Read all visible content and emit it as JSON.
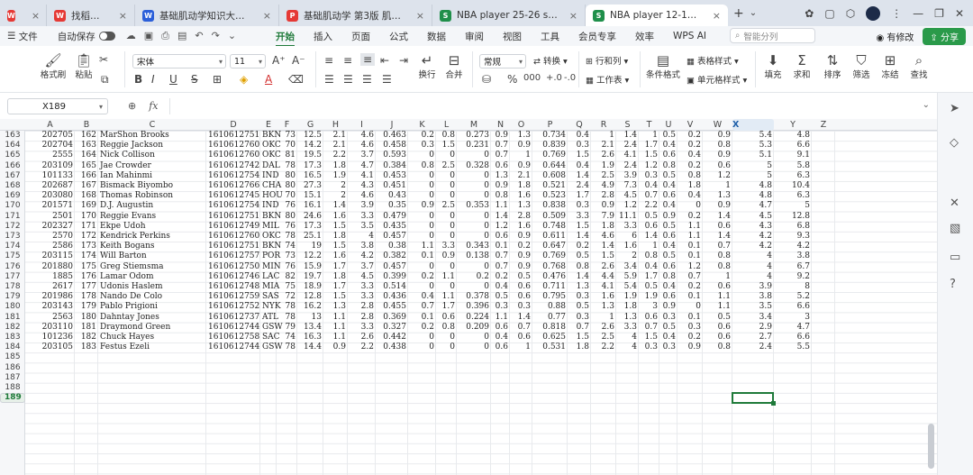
{
  "tabs": [
    {
      "label": "WPS",
      "icon": "wps-logo-icon",
      "color": "#e53935"
    },
    {
      "label": "找稻壳模板",
      "icon": "docer-icon",
      "color": "#e53935"
    },
    {
      "label": "基础肌动学知识大纲.docx",
      "icon": "word-doc-icon",
      "color": "#2b5fd9"
    },
    {
      "label": "基础肌动学 第3版 肌肉骨骼系统结构...",
      "icon": "pdf-icon",
      "color": "#e53935"
    },
    {
      "label": "NBA player 25-26 stats.xlsx",
      "icon": "sheet-icon",
      "color": "#1f8f4a"
    },
    {
      "label": "NBA player 12-13 stats.xlsx",
      "icon": "sheet-icon",
      "color": "#1f8f4a",
      "active": true
    }
  ],
  "menu": {
    "file": "文件",
    "autosave": "自动保存",
    "ribbon_tabs": [
      "开始",
      "插入",
      "页面",
      "公式",
      "数据",
      "审阅",
      "视图",
      "工具",
      "会员专享",
      "效率",
      "WPS AI"
    ],
    "active_tab": "开始",
    "search_placeholder": "智能分列",
    "modified": "有修改",
    "share": "分享"
  },
  "ribbon": {
    "format_painter": "格式刷",
    "paste": "粘贴",
    "font_name": "宋体",
    "font_size": "11",
    "wrap": "换行",
    "merge": "合并",
    "number_format": "常规",
    "convert": "转换",
    "rows_cols": "行和列",
    "worksheet": "工作表",
    "cond_format": "条件格式",
    "table_style": "表格样式",
    "cell_style": "单元格样式",
    "fill": "填充",
    "sum": "求和",
    "sort": "排序",
    "filter": "筛选",
    "freeze": "冻结",
    "find": "查找"
  },
  "formula_bar": {
    "cell_ref": "X189",
    "fx": "fx",
    "value": ""
  },
  "columns": [
    "A",
    "B",
    "C",
    "D",
    "E",
    "F",
    "G",
    "H",
    "I",
    "J",
    "K",
    "L",
    "M",
    "N",
    "O",
    "P",
    "Q",
    "R",
    "S",
    "T",
    "U",
    "V",
    "W",
    "X",
    "Y",
    "Z"
  ],
  "selected_column": "X",
  "selected_row": "189",
  "rows": [
    {
      "n": "163",
      "c": [
        "202705",
        "162",
        "MarShon Brooks",
        "1610612751",
        "BKN",
        "73",
        "12.5",
        "2.1",
        "4.6",
        "0.463",
        "0.2",
        "0.8",
        "0.273",
        "0.9",
        "1.3",
        "0.734",
        "0.4",
        "1",
        "1.4",
        "1",
        "0.5",
        "0.2",
        "0.9",
        "5.4",
        "4.8"
      ]
    },
    {
      "n": "164",
      "c": [
        "202704",
        "163",
        "Reggie Jackson",
        "1610612760",
        "OKC",
        "70",
        "14.2",
        "2.1",
        "4.6",
        "0.458",
        "0.3",
        "1.5",
        "0.231",
        "0.7",
        "0.9",
        "0.839",
        "0.3",
        "2.1",
        "2.4",
        "1.7",
        "0.4",
        "0.2",
        "0.8",
        "5.3",
        "6.6"
      ]
    },
    {
      "n": "165",
      "c": [
        "2555",
        "164",
        "Nick Collison",
        "1610612760",
        "OKC",
        "81",
        "19.5",
        "2.2",
        "3.7",
        "0.593",
        "0",
        "0",
        "0",
        "0.7",
        "1",
        "0.769",
        "1.5",
        "2.6",
        "4.1",
        "1.5",
        "0.6",
        "0.4",
        "0.9",
        "5.1",
        "9.1"
      ]
    },
    {
      "n": "166",
      "c": [
        "203109",
        "165",
        "Jae Crowder",
        "1610612742",
        "DAL",
        "78",
        "17.3",
        "1.8",
        "4.7",
        "0.384",
        "0.8",
        "2.5",
        "0.328",
        "0.6",
        "0.9",
        "0.644",
        "0.4",
        "1.9",
        "2.4",
        "1.2",
        "0.8",
        "0.2",
        "0.6",
        "5",
        "5.8"
      ]
    },
    {
      "n": "167",
      "c": [
        "101133",
        "166",
        "Ian Mahinmi",
        "1610612754",
        "IND",
        "80",
        "16.5",
        "1.9",
        "4.1",
        "0.453",
        "0",
        "0",
        "0",
        "1.3",
        "2.1",
        "0.608",
        "1.4",
        "2.5",
        "3.9",
        "0.3",
        "0.5",
        "0.8",
        "1.2",
        "5",
        "6.3"
      ]
    },
    {
      "n": "168",
      "c": [
        "202687",
        "167",
        "Bismack Biyombo",
        "1610612766",
        "CHA",
        "80",
        "27.3",
        "2",
        "4.3",
        "0.451",
        "0",
        "0",
        "0",
        "0.9",
        "1.8",
        "0.521",
        "2.4",
        "4.9",
        "7.3",
        "0.4",
        "0.4",
        "1.8",
        "1",
        "4.8",
        "10.4"
      ]
    },
    {
      "n": "169",
      "c": [
        "203080",
        "168",
        "Thomas Robinson",
        "1610612745",
        "HOU",
        "70",
        "15.1",
        "2",
        "4.6",
        "0.43",
        "0",
        "0",
        "0",
        "0.8",
        "1.6",
        "0.523",
        "1.7",
        "2.8",
        "4.5",
        "0.7",
        "0.6",
        "0.4",
        "1.3",
        "4.8",
        "6.3"
      ]
    },
    {
      "n": "170",
      "c": [
        "201571",
        "169",
        "D.J. Augustin",
        "1610612754",
        "IND",
        "76",
        "16.1",
        "1.4",
        "3.9",
        "0.35",
        "0.9",
        "2.5",
        "0.353",
        "1.1",
        "1.3",
        "0.838",
        "0.3",
        "0.9",
        "1.2",
        "2.2",
        "0.4",
        "0",
        "0.9",
        "4.7",
        "5"
      ]
    },
    {
      "n": "171",
      "c": [
        "2501",
        "170",
        "Reggie Evans",
        "1610612751",
        "BKN",
        "80",
        "24.6",
        "1.6",
        "3.3",
        "0.479",
        "0",
        "0",
        "0",
        "1.4",
        "2.8",
        "0.509",
        "3.3",
        "7.9",
        "11.1",
        "0.5",
        "0.9",
        "0.2",
        "1.4",
        "4.5",
        "12.8"
      ]
    },
    {
      "n": "172",
      "c": [
        "202327",
        "171",
        "Ekpe Udoh",
        "1610612749",
        "MIL",
        "76",
        "17.3",
        "1.5",
        "3.5",
        "0.435",
        "0",
        "0",
        "0",
        "1.2",
        "1.6",
        "0.748",
        "1.5",
        "1.8",
        "3.3",
        "0.6",
        "0.5",
        "1.1",
        "0.6",
        "4.3",
        "6.8"
      ]
    },
    {
      "n": "173",
      "c": [
        "2570",
        "172",
        "Kendrick Perkins",
        "1610612760",
        "OKC",
        "78",
        "25.1",
        "1.8",
        "4",
        "0.457",
        "0",
        "0",
        "0",
        "0.6",
        "0.9",
        "0.611",
        "1.4",
        "4.6",
        "6",
        "1.4",
        "0.6",
        "1.1",
        "1.4",
        "4.2",
        "9.3"
      ]
    },
    {
      "n": "174",
      "c": [
        "2586",
        "173",
        "Keith Bogans",
        "1610612751",
        "BKN",
        "74",
        "19",
        "1.5",
        "3.8",
        "0.38",
        "1.1",
        "3.3",
        "0.343",
        "0.1",
        "0.2",
        "0.647",
        "0.2",
        "1.4",
        "1.6",
        "1",
        "0.4",
        "0.1",
        "0.7",
        "4.2",
        "4.2"
      ]
    },
    {
      "n": "175",
      "c": [
        "203115",
        "174",
        "Will Barton",
        "1610612757",
        "POR",
        "73",
        "12.2",
        "1.6",
        "4.2",
        "0.382",
        "0.1",
        "0.9",
        "0.138",
        "0.7",
        "0.9",
        "0.769",
        "0.5",
        "1.5",
        "2",
        "0.8",
        "0.5",
        "0.1",
        "0.8",
        "4",
        "3.8"
      ]
    },
    {
      "n": "176",
      "c": [
        "201880",
        "175",
        "Greg Stiemsma",
        "1610612750",
        "MIN",
        "76",
        "15.9",
        "1.7",
        "3.7",
        "0.457",
        "0",
        "0",
        "0",
        "0.7",
        "0.9",
        "0.768",
        "0.8",
        "2.6",
        "3.4",
        "0.4",
        "0.6",
        "1.2",
        "0.8",
        "4",
        "6.7"
      ]
    },
    {
      "n": "177",
      "c": [
        "1885",
        "176",
        "Lamar Odom",
        "1610612746",
        "LAC",
        "82",
        "19.7",
        "1.8",
        "4.5",
        "0.399",
        "0.2",
        "1.1",
        "0.2",
        "0.2",
        "0.5",
        "0.476",
        "1.4",
        "4.4",
        "5.9",
        "1.7",
        "0.8",
        "0.7",
        "1",
        "4",
        "9.2"
      ]
    },
    {
      "n": "178",
      "c": [
        "2617",
        "177",
        "Udonis Haslem",
        "1610612748",
        "MIA",
        "75",
        "18.9",
        "1.7",
        "3.3",
        "0.514",
        "0",
        "0",
        "0",
        "0.4",
        "0.6",
        "0.711",
        "1.3",
        "4.1",
        "5.4",
        "0.5",
        "0.4",
        "0.2",
        "0.6",
        "3.9",
        "8"
      ]
    },
    {
      "n": "179",
      "c": [
        "201986",
        "178",
        "Nando De Colo",
        "1610612759",
        "SAS",
        "72",
        "12.8",
        "1.5",
        "3.3",
        "0.436",
        "0.4",
        "1.1",
        "0.378",
        "0.5",
        "0.6",
        "0.795",
        "0.3",
        "1.6",
        "1.9",
        "1.9",
        "0.6",
        "0.1",
        "1.1",
        "3.8",
        "5.2"
      ]
    },
    {
      "n": "180",
      "c": [
        "203143",
        "179",
        "Pablo Prigioni",
        "1610612752",
        "NYK",
        "78",
        "16.2",
        "1.3",
        "2.8",
        "0.455",
        "0.7",
        "1.7",
        "0.396",
        "0.3",
        "0.3",
        "0.88",
        "0.5",
        "1.3",
        "1.8",
        "3",
        "0.9",
        "0",
        "1.1",
        "3.5",
        "6.6"
      ]
    },
    {
      "n": "181",
      "c": [
        "2563",
        "180",
        "Dahntay Jones",
        "1610612737",
        "ATL",
        "78",
        "13",
        "1.1",
        "2.8",
        "0.369",
        "0.1",
        "0.6",
        "0.224",
        "1.1",
        "1.4",
        "0.77",
        "0.3",
        "1",
        "1.3",
        "0.6",
        "0.3",
        "0.1",
        "0.5",
        "3.4",
        "3"
      ]
    },
    {
      "n": "182",
      "c": [
        "203110",
        "181",
        "Draymond Green",
        "1610612744",
        "GSW",
        "79",
        "13.4",
        "1.1",
        "3.3",
        "0.327",
        "0.2",
        "0.8",
        "0.209",
        "0.6",
        "0.7",
        "0.818",
        "0.7",
        "2.6",
        "3.3",
        "0.7",
        "0.5",
        "0.3",
        "0.6",
        "2.9",
        "4.7"
      ]
    },
    {
      "n": "183",
      "c": [
        "101236",
        "182",
        "Chuck Hayes",
        "1610612758",
        "SAC",
        "74",
        "16.3",
        "1.1",
        "2.6",
        "0.442",
        "0",
        "0",
        "0",
        "0.4",
        "0.6",
        "0.625",
        "1.5",
        "2.5",
        "4",
        "1.5",
        "0.4",
        "0.2",
        "0.6",
        "2.7",
        "6.6"
      ]
    },
    {
      "n": "184",
      "c": [
        "203105",
        "183",
        "Festus Ezeli",
        "1610612744",
        "GSW",
        "78",
        "14.4",
        "0.9",
        "2.2",
        "0.438",
        "0",
        "0",
        "0",
        "0.6",
        "1",
        "0.531",
        "1.8",
        "2.2",
        "4",
        "0.3",
        "0.3",
        "0.9",
        "0.8",
        "2.4",
        "5.5"
      ]
    },
    {
      "n": "185",
      "c": []
    },
    {
      "n": "186",
      "c": []
    },
    {
      "n": "187",
      "c": []
    },
    {
      "n": "188",
      "c": []
    },
    {
      "n": "189",
      "c": []
    }
  ],
  "rail_icons": [
    "pointer-icon",
    "shapes-icon",
    "tools-icon",
    "image-icon",
    "book-icon",
    "help-icon"
  ],
  "colors": {
    "accent": "#1f7a3a",
    "share": "#2a9a4a"
  }
}
